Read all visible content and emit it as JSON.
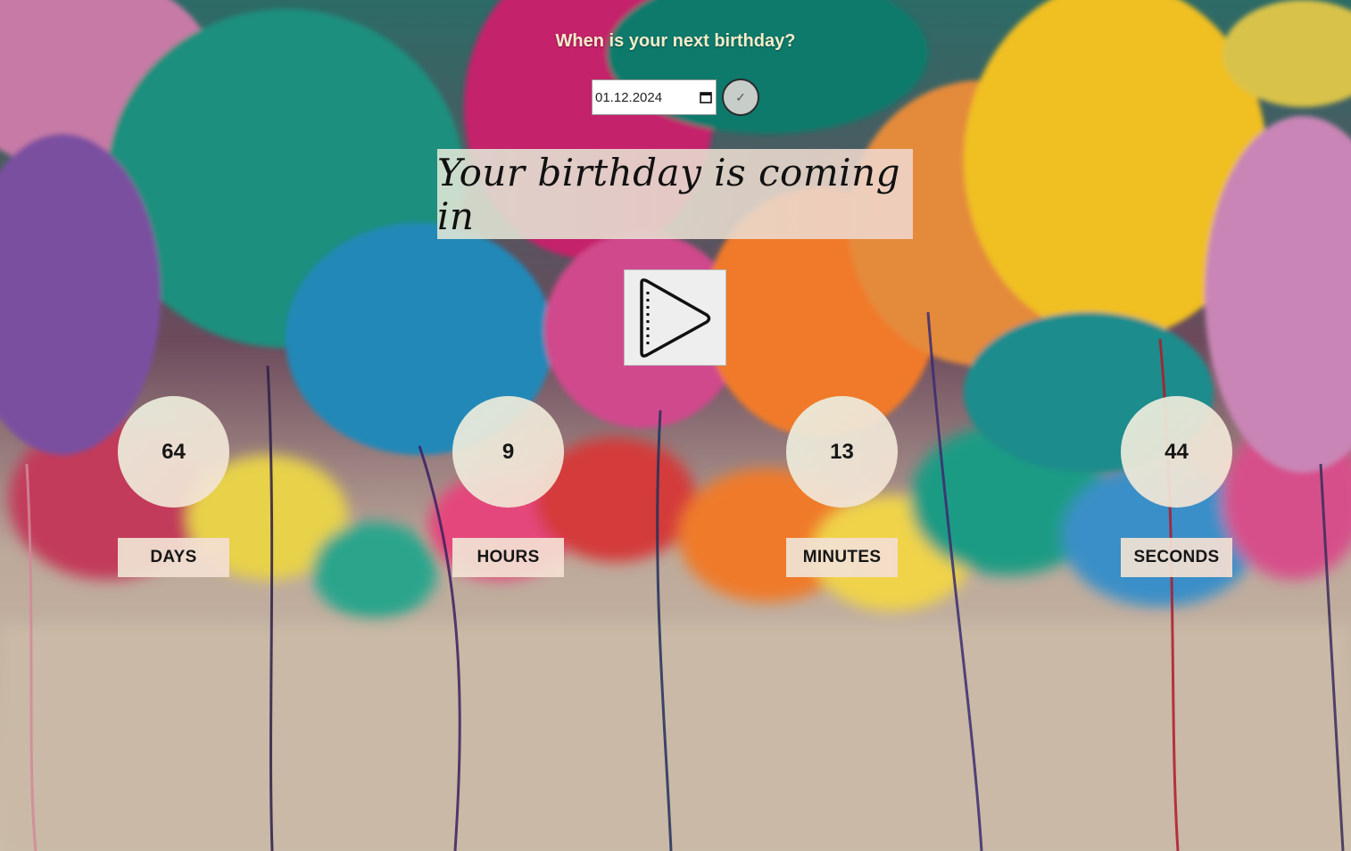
{
  "prompt": {
    "question": "When is your next birthday?"
  },
  "date_input": {
    "value": "01.12.2024"
  },
  "confirm_button": {
    "label": "✓"
  },
  "headline": {
    "text": "Your birthday is coming in"
  },
  "countdown": [
    {
      "value": "64",
      "unit": "DAYS"
    },
    {
      "value": "9",
      "unit": "HOURS"
    },
    {
      "value": "13",
      "unit": "MINUTES"
    },
    {
      "value": "44",
      "unit": "SECONDS"
    }
  ],
  "icons": {
    "play": "play-icon",
    "calendar": "calendar-icon",
    "check": "check-icon"
  },
  "colors": {
    "question_text": "#f5ecc9",
    "panel_tint": "#e8eede"
  }
}
